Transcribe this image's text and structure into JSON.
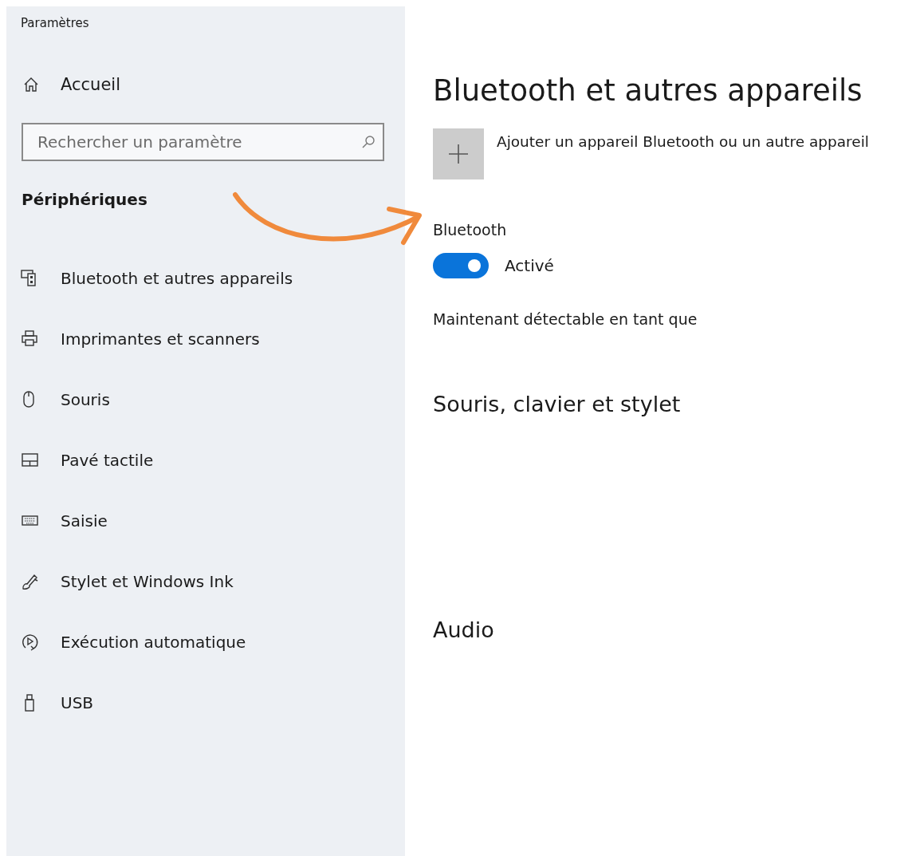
{
  "window": {
    "title": "Paramètres"
  },
  "home": {
    "label": "Accueil"
  },
  "search": {
    "placeholder": "Rechercher un paramètre"
  },
  "section": "Périphériques",
  "nav_items": [
    {
      "label": "Bluetooth et autres appareils",
      "selected": false
    },
    {
      "label": "Imprimantes et scanners",
      "selected": false
    },
    {
      "label": "Souris",
      "selected": false
    },
    {
      "label": "Pavé tactile",
      "selected": false
    },
    {
      "label": "Saisie",
      "selected": false
    },
    {
      "label": "Stylet et Windows Ink",
      "selected": false
    },
    {
      "label": "Exécution automatique",
      "selected": false
    },
    {
      "label": "USB",
      "selected": false
    }
  ],
  "content": {
    "title": "Bluetooth et autres appareils",
    "add_device": {
      "label": "Ajouter un appareil Bluetooth ou un autre appareil"
    },
    "bluetooth": {
      "label": "Bluetooth",
      "on": true,
      "state_label": "Activé"
    },
    "discoverable": "Maintenant détectable en tant que",
    "sections": [
      "Souris, clavier et stylet",
      "Audio"
    ]
  }
}
